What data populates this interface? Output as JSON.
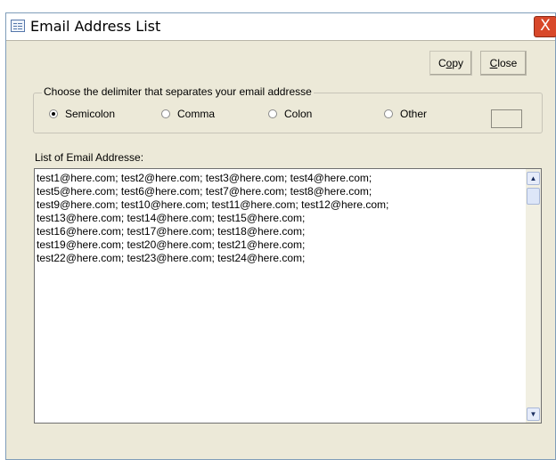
{
  "window": {
    "title": "Email Address List",
    "close_glyph": "X"
  },
  "toolbar": {
    "copy_label_pre": "C",
    "copy_label_ul": "o",
    "copy_label_post": "py",
    "close_label_ul": "C",
    "close_label_post": "lose"
  },
  "delimiter": {
    "legend": "Choose the delimiter that separates your email addresse",
    "options": [
      "Semicolon",
      "Comma",
      "Colon",
      "Other"
    ],
    "selected": "Semicolon",
    "other_value": ""
  },
  "list": {
    "label": "List of Email Addresse:",
    "lines": [
      "test1@here.com; test2@here.com; test3@here.com; test4@here.com;",
      "test5@here.com; test6@here.com; test7@here.com; test8@here.com;",
      "test9@here.com; test10@here.com; test11@here.com; test12@here.com;",
      "test13@here.com; test14@here.com; test15@here.com;",
      "test16@here.com; test17@here.com; test18@here.com;",
      "test19@here.com; test20@here.com; test21@here.com;",
      "test22@here.com; test23@here.com; test24@here.com;"
    ]
  },
  "icons": {
    "app": "form-icon",
    "close": "close-icon",
    "scroll_up": "chevron-up-icon",
    "scroll_down": "chevron-down-icon"
  },
  "colors": {
    "window_bg": "#ece9d8",
    "close_red": "#d8482a"
  }
}
